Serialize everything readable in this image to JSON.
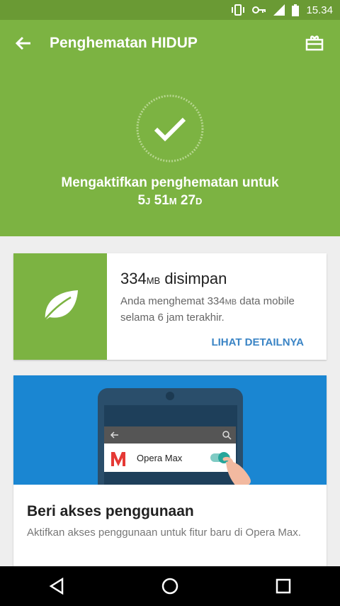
{
  "status_bar": {
    "time": "15.34",
    "icons": [
      "vibrate-icon",
      "vpn-key-icon",
      "signal-icon",
      "battery-icon"
    ]
  },
  "app_bar": {
    "title": "Penghematan HIDUP",
    "back_icon": "arrow-back-icon",
    "gift_icon": "gift-icon",
    "color": "#7cb342"
  },
  "status": {
    "line1": "Mengaktifkan penghematan untuk",
    "hours": "5",
    "hours_unit": "J",
    "minutes": "51",
    "minutes_unit": "M",
    "seconds": "27",
    "seconds_unit": "D"
  },
  "savings_card": {
    "amount": "334",
    "unit": "MB",
    "saved_label": " disimpan",
    "desc_prefix": "Anda menghemat 334",
    "desc_unit": "MB",
    "desc_suffix": " data mobile selama 6 jam terakhir.",
    "link": "LIHAT DETAILNYA",
    "icon": "leaf-icon"
  },
  "access_card": {
    "banner_app_name": "Opera Max",
    "heading": "Beri akses penggunaan",
    "body": "Aktifkan akses penggunaan untuk fitur baru di Opera Max."
  },
  "nav_bar": {
    "icons": [
      "back-triangle-icon",
      "home-circle-icon",
      "recents-square-icon"
    ]
  }
}
